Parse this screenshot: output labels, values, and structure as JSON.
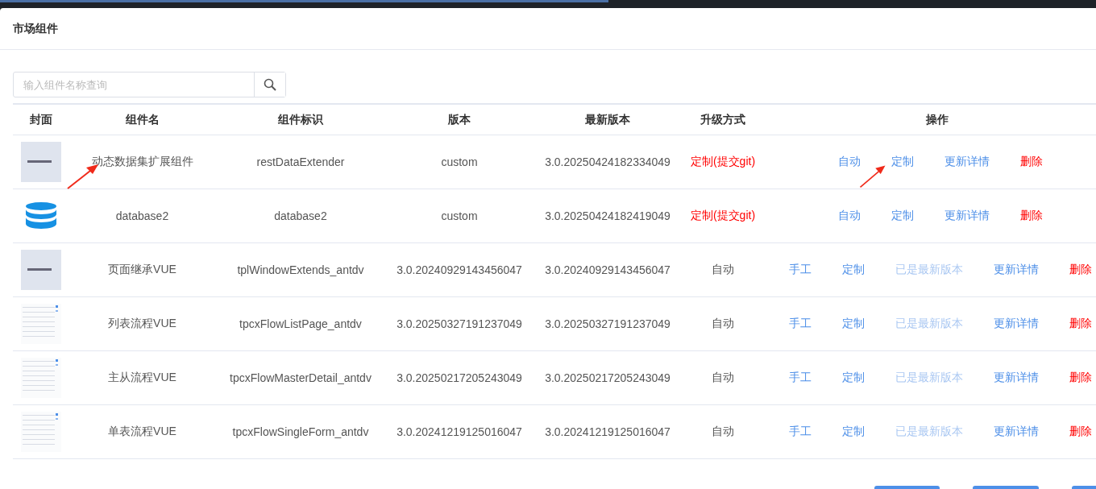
{
  "dialog": {
    "title": "市场组件"
  },
  "search": {
    "placeholder": "输入组件名称查询"
  },
  "table": {
    "columns": [
      "封面",
      "组件名",
      "组件标识",
      "版本",
      "最新版本",
      "升级方式",
      "操作"
    ],
    "rows": [
      {
        "cover": {
          "kind": "grey-card"
        },
        "name": "动态数据集扩展组件",
        "identifier": "restDataExtender",
        "version": "custom",
        "latest_version": "3.0.20250424182334049",
        "upgrade": {
          "text": "定制(提交git)",
          "highlight": true
        },
        "actions": [
          {
            "label": "自动",
            "kind": "link"
          },
          {
            "label": "定制",
            "kind": "link"
          },
          {
            "label": "更新详情",
            "kind": "link"
          },
          {
            "label": "删除",
            "kind": "danger"
          }
        ]
      },
      {
        "cover": {
          "kind": "database"
        },
        "name": "database2",
        "identifier": "database2",
        "version": "custom",
        "latest_version": "3.0.20250424182419049",
        "upgrade": {
          "text": "定制(提交git)",
          "highlight": true
        },
        "actions": [
          {
            "label": "自动",
            "kind": "link"
          },
          {
            "label": "定制",
            "kind": "link"
          },
          {
            "label": "更新详情",
            "kind": "link"
          },
          {
            "label": "删除",
            "kind": "danger"
          }
        ]
      },
      {
        "cover": {
          "kind": "grey-card"
        },
        "name": "页面继承VUE",
        "identifier": "tplWindowExtends_antdv",
        "version": "3.0.20240929143456047",
        "latest_version": "3.0.20240929143456047",
        "upgrade": {
          "text": "自动",
          "highlight": false
        },
        "actions": [
          {
            "label": "手工",
            "kind": "link"
          },
          {
            "label": "定制",
            "kind": "link"
          },
          {
            "label": "已是最新版本",
            "kind": "disabled"
          },
          {
            "label": "更新详情",
            "kind": "link"
          },
          {
            "label": "删除",
            "kind": "danger"
          }
        ]
      },
      {
        "cover": {
          "kind": "page-screenshot"
        },
        "name": "列表流程VUE",
        "identifier": "tpcxFlowListPage_antdv",
        "version": "3.0.20250327191237049",
        "latest_version": "3.0.20250327191237049",
        "upgrade": {
          "text": "自动",
          "highlight": false
        },
        "actions": [
          {
            "label": "手工",
            "kind": "link"
          },
          {
            "label": "定制",
            "kind": "link"
          },
          {
            "label": "已是最新版本",
            "kind": "disabled"
          },
          {
            "label": "更新详情",
            "kind": "link"
          },
          {
            "label": "删除",
            "kind": "danger"
          }
        ]
      },
      {
        "cover": {
          "kind": "page-screenshot"
        },
        "name": "主从流程VUE",
        "identifier": "tpcxFlowMasterDetail_antdv",
        "version": "3.0.20250217205243049",
        "latest_version": "3.0.20250217205243049",
        "upgrade": {
          "text": "自动",
          "highlight": false
        },
        "actions": [
          {
            "label": "手工",
            "kind": "link"
          },
          {
            "label": "定制",
            "kind": "link"
          },
          {
            "label": "已是最新版本",
            "kind": "disabled"
          },
          {
            "label": "更新详情",
            "kind": "link"
          },
          {
            "label": "删除",
            "kind": "danger"
          }
        ]
      },
      {
        "cover": {
          "kind": "page-screenshot"
        },
        "name": "单表流程VUE",
        "identifier": "tpcxFlowSingleForm_antdv",
        "version": "3.0.20241219125016047",
        "latest_version": "3.0.20241219125016047",
        "upgrade": {
          "text": "自动",
          "highlight": false
        },
        "actions": [
          {
            "label": "手工",
            "kind": "link"
          },
          {
            "label": "定制",
            "kind": "link"
          },
          {
            "label": "已是最新版本",
            "kind": "disabled"
          },
          {
            "label": "更新详情",
            "kind": "link"
          },
          {
            "label": "删除",
            "kind": "danger"
          }
        ]
      }
    ]
  }
}
